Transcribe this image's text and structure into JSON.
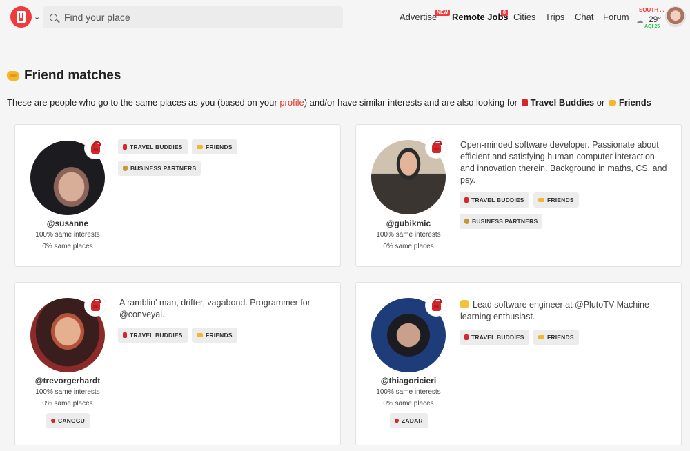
{
  "header": {
    "search_placeholder": "Find your place",
    "nav": {
      "advertise": "Advertise",
      "advertise_badge": "NEW",
      "remote_jobs": "Remote Jobs",
      "remote_jobs_badge": "8",
      "cities": "Cities",
      "trips": "Trips",
      "chat": "Chat",
      "forum": "Forum"
    },
    "weather": {
      "city": "SOUTH ...",
      "temp": "29°",
      "aqi": "AQI 25"
    }
  },
  "page": {
    "title": "Friend matches",
    "intro_pre": "These are people who go to the same places as you (based on your ",
    "intro_link": "profile",
    "intro_mid": ") and/or have similar interests and are also looking for ",
    "intro_travel": "Travel Buddies",
    "intro_or": " or ",
    "intro_friends": "Friends"
  },
  "matches": [
    {
      "username": "@susanne",
      "interests": "100% same interests",
      "places": "0% same places",
      "bio": "",
      "tags": [
        "TRAVEL BUDDIES",
        "FRIENDS",
        "BUSINESS PARTNERS"
      ],
      "location": ""
    },
    {
      "username": "@gubikmic",
      "interests": "100% same interests",
      "places": "0% same places",
      "bio": "Open-minded software developer. Passionate about efficient and satisfying human-computer interaction and innovation therein. Background in maths, CS, and psy.",
      "tags": [
        "TRAVEL BUDDIES",
        "FRIENDS",
        "BUSINESS PARTNERS"
      ],
      "location": ""
    },
    {
      "username": "@trevorgerhardt",
      "interests": "100% same interests",
      "places": "0% same places",
      "bio": "A ramblin' man, drifter, vagabond. Programmer for @conveyal.",
      "tags": [
        "TRAVEL BUDDIES",
        "FRIENDS"
      ],
      "location": "CANGGU"
    },
    {
      "username": "@thiagoricieri",
      "interests": "100% same interests",
      "places": "0% same places",
      "bio": "Lead software engineer at @PlutoTV Machine learning enthusiast.",
      "tags": [
        "TRAVEL BUDDIES",
        "FRIENDS"
      ],
      "location": "ZADAR"
    }
  ]
}
